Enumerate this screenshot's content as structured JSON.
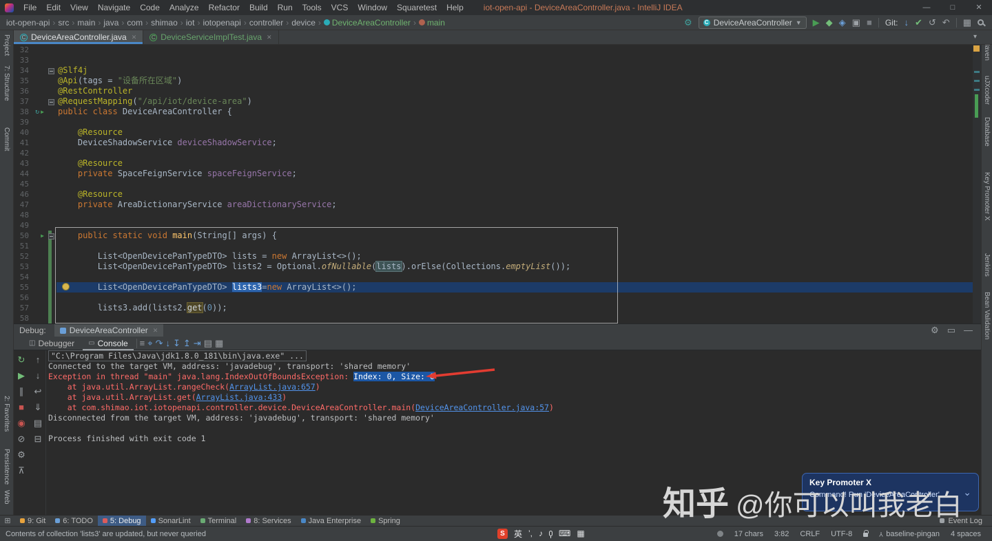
{
  "titlebar": {
    "menu": [
      "File",
      "Edit",
      "View",
      "Navigate",
      "Code",
      "Analyze",
      "Refactor",
      "Build",
      "Run",
      "Tools",
      "VCS",
      "Window",
      "Squaretest",
      "Help"
    ],
    "title": "iot-open-api - DeviceAreaController.java - IntelliJ IDEA",
    "controls": [
      {
        "name": "minimize-button",
        "glyph": "—"
      },
      {
        "name": "maximize-button",
        "glyph": "□"
      },
      {
        "name": "close-button",
        "glyph": "✕"
      }
    ]
  },
  "navbar": {
    "breadcrumbs": [
      {
        "label": "iot-open-api"
      },
      {
        "label": "src"
      },
      {
        "label": "main"
      },
      {
        "label": "java"
      },
      {
        "label": "com"
      },
      {
        "label": "shimao"
      },
      {
        "label": "iot"
      },
      {
        "label": "iotopenapi"
      },
      {
        "label": "controller"
      },
      {
        "label": "device"
      },
      {
        "label": "DeviceAreaController",
        "icon": "class",
        "accent": true
      },
      {
        "label": "main",
        "icon": "method",
        "accent": true
      }
    ],
    "run_config": "DeviceAreaController",
    "git_label": "Git:",
    "actions_left": [
      {
        "name": "wrench-icon",
        "glyph": "⚙",
        "color": "#3f9e9a"
      }
    ],
    "actions_run": [
      {
        "name": "run-icon",
        "glyph": "▶",
        "color": "#499c54"
      },
      {
        "name": "debug-icon",
        "glyph": "◆",
        "color": "#73bd79"
      },
      {
        "name": "profiler-icon",
        "glyph": "◈",
        "color": "#6a9fd8"
      },
      {
        "name": "coverage-icon",
        "glyph": "▣",
        "color": "#9da2a6"
      },
      {
        "name": "stop-icon",
        "glyph": "■",
        "color": "#777b80"
      }
    ],
    "actions_git": [
      {
        "name": "git-update-icon",
        "glyph": "↓",
        "color": "#6a9fd8"
      },
      {
        "name": "git-commit-icon",
        "glyph": "✔",
        "color": "#73bd79"
      },
      {
        "name": "history-icon",
        "glyph": "↺",
        "color": "#9da2a6"
      },
      {
        "name": "rollback-icon",
        "glyph": "↶",
        "color": "#9da2a6"
      }
    ],
    "actions_end": [
      {
        "name": "layout-icon",
        "glyph": "▦",
        "color": "#9da2a6"
      }
    ]
  },
  "editor_tabs": [
    {
      "label": "DeviceAreaController.java",
      "letter": "C",
      "active": true
    },
    {
      "label": "DeviceServiceImplTest.java",
      "letter": "C",
      "test": true
    }
  ],
  "left_strip": {
    "top": [
      "Project",
      "7: Structure",
      "Commit"
    ],
    "bottom": [
      "2: Favorites",
      "Persistence",
      "Web"
    ]
  },
  "right_strip": [
    "Maven",
    "uJXcoder",
    "Database",
    "Key Promoter X",
    "Jenkins",
    "Bean Validation"
  ],
  "editor": {
    "lines": [
      {
        "n": 32,
        "s": []
      },
      {
        "n": 33,
        "s": []
      },
      {
        "n": 34,
        "g": [
          "fold"
        ],
        "s": [
          [
            "@Slf4j",
            "ann"
          ]
        ]
      },
      {
        "n": 35,
        "s": [
          [
            "@Api",
            "ann"
          ],
          [
            "(tags = ",
            "p"
          ],
          [
            "\"设备所在区域\"",
            "str"
          ],
          [
            ")",
            "p"
          ]
        ]
      },
      {
        "n": 36,
        "s": [
          [
            "@RestController",
            "ann"
          ]
        ]
      },
      {
        "n": 37,
        "g": [
          "fold"
        ],
        "s": [
          [
            "@RequestMapping",
            "ann"
          ],
          [
            "(",
            "p"
          ],
          [
            "\"/api/iot/device-area\"",
            "str"
          ],
          [
            ")",
            "p"
          ]
        ]
      },
      {
        "n": 38,
        "g": [
          "runclass",
          "run"
        ],
        "s": [
          [
            "public class ",
            "kw"
          ],
          [
            "DeviceAreaController {",
            "p"
          ]
        ]
      },
      {
        "n": 39,
        "s": []
      },
      {
        "n": 40,
        "s": [
          [
            "    ",
            "p"
          ],
          [
            "@Resource",
            "ann"
          ]
        ]
      },
      {
        "n": 41,
        "s": [
          [
            "    DeviceShadowService ",
            "p"
          ],
          [
            "deviceShadowService",
            "fld"
          ],
          [
            ";",
            "p"
          ]
        ]
      },
      {
        "n": 42,
        "s": []
      },
      {
        "n": 43,
        "s": [
          [
            "    ",
            "p"
          ],
          [
            "@Resource",
            "ann"
          ]
        ]
      },
      {
        "n": 44,
        "s": [
          [
            "    ",
            "p"
          ],
          [
            "private ",
            "kw"
          ],
          [
            "SpaceFeignService ",
            "p"
          ],
          [
            "spaceFeignService",
            "fld"
          ],
          [
            ";",
            "p"
          ]
        ]
      },
      {
        "n": 45,
        "s": []
      },
      {
        "n": 46,
        "s": [
          [
            "    ",
            "p"
          ],
          [
            "@Resource",
            "ann"
          ]
        ]
      },
      {
        "n": 47,
        "s": [
          [
            "    ",
            "p"
          ],
          [
            "private ",
            "kw"
          ],
          [
            "AreaDictionaryService ",
            "p"
          ],
          [
            "areaDictionaryService",
            "fld"
          ],
          [
            ";",
            "p"
          ]
        ]
      },
      {
        "n": 48,
        "s": []
      },
      {
        "n": 49,
        "s": []
      },
      {
        "n": 50,
        "g": [
          "fold",
          "run"
        ],
        "v": true,
        "s": [
          [
            "    ",
            "p"
          ],
          [
            "public static void ",
            "kw"
          ],
          [
            "main",
            "meth"
          ],
          [
            "(String[] args) {",
            "p"
          ]
        ]
      },
      {
        "n": 51,
        "v": true,
        "s": []
      },
      {
        "n": 52,
        "v": true,
        "s": [
          [
            "        List<OpenDevicePanTypeDTO> lists = ",
            "p"
          ],
          [
            "new ",
            "kw"
          ],
          [
            "ArrayList<>();",
            "p"
          ]
        ]
      },
      {
        "n": 53,
        "v": true,
        "s": [
          [
            "        List<OpenDevicePanTypeDTO> lists2 = Optional.",
            "p"
          ],
          [
            "ofNullable",
            "it"
          ],
          [
            "(",
            "p"
          ],
          [
            "lists",
            "hl1"
          ],
          [
            ").orElse(Collections.",
            "p"
          ],
          [
            "emptyList",
            "it"
          ],
          [
            "());",
            "p"
          ]
        ]
      },
      {
        "n": 54,
        "v": true,
        "s": []
      },
      {
        "n": 55,
        "v": true,
        "caret": true,
        "s": [
          [
            "        List<OpenDevicePanTypeDTO> ",
            "p"
          ],
          [
            "lists3",
            "hl2"
          ],
          [
            "=",
            "p"
          ],
          [
            "new ",
            "kw"
          ],
          [
            "ArrayList<>();",
            "p"
          ]
        ]
      },
      {
        "n": 56,
        "v": true,
        "s": []
      },
      {
        "n": 57,
        "v": true,
        "s": [
          [
            "        lists3.add(lists2.",
            "p"
          ],
          [
            "get",
            "hl3"
          ],
          [
            "(",
            "p"
          ],
          [
            "0",
            "num"
          ],
          [
            "));",
            "p"
          ]
        ]
      },
      {
        "n": 58,
        "v": true,
        "s": []
      }
    ]
  },
  "debug": {
    "panel_label": "Debug:",
    "tab": "DeviceAreaController",
    "views": [
      {
        "label": "Debugger",
        "glyph": "◫",
        "active": false
      },
      {
        "label": "Console",
        "glyph": "▭",
        "active": true
      }
    ],
    "toolbar": [
      {
        "name": "options-menu-icon",
        "glyph": "≡"
      },
      {
        "name": "show-execution-point-icon",
        "glyph": "⌖",
        "color": "#6a9fd8"
      },
      {
        "name": "step-over-icon",
        "glyph": "↷",
        "color": "#6a9fd8"
      },
      {
        "name": "step-into-icon",
        "glyph": "↓",
        "color": "#6a9fd8"
      },
      {
        "name": "force-step-into-icon",
        "glyph": "↧",
        "color": "#6a9fd8"
      },
      {
        "name": "step-out-icon",
        "glyph": "↥",
        "color": "#6a9fd8"
      },
      {
        "name": "run-to-cursor-icon",
        "glyph": "⇥",
        "color": "#6a9fd8"
      },
      {
        "name": "evaluate-expression-icon",
        "glyph": "▤",
        "color": "#9da2a6"
      },
      {
        "name": "layout-settings-icon",
        "glyph": "▦",
        "color": "#9da2a6"
      }
    ],
    "left_actions": [
      {
        "name": "rerun-icon",
        "glyph": "↻",
        "color": "#73bd79"
      },
      {
        "name": "resume-icon",
        "glyph": "▶",
        "color": "#73bd79"
      },
      {
        "name": "pause-icon",
        "glyph": "∥",
        "color": "#9da2a6"
      },
      {
        "name": "stop-icon",
        "glyph": "■",
        "color": "#c75450"
      },
      {
        "name": "view-breakpoints-icon",
        "glyph": "◉",
        "color": "#c75450"
      },
      {
        "name": "mute-breakpoints-icon",
        "glyph": "⊘",
        "color": "#9da2a6"
      },
      {
        "name": "settings-icon",
        "glyph": "⚙",
        "color": "#9da2a6"
      },
      {
        "name": "pin-icon",
        "glyph": "⊼",
        "color": "#9da2a6"
      }
    ],
    "console_actions": [
      {
        "name": "jump-to-top-icon",
        "glyph": "↑",
        "color": "#9da2a6"
      },
      {
        "name": "jump-to-bottom-icon",
        "glyph": "↓",
        "color": "#9da2a6"
      },
      {
        "name": "soft-wrap-icon",
        "glyph": "↩",
        "color": "#9da2a6"
      },
      {
        "name": "scroll-to-end-icon",
        "glyph": "⇓",
        "color": "#9da2a6"
      },
      {
        "name": "print-icon",
        "glyph": "▤",
        "color": "#9da2a6"
      },
      {
        "name": "clear-console-icon",
        "glyph": "⊟",
        "color": "#9da2a6"
      }
    ],
    "header_actions": [
      {
        "name": "settings-gear-icon",
        "glyph": "⚙"
      },
      {
        "name": "float-mode-icon",
        "glyph": "▭"
      },
      {
        "name": "hide-icon",
        "glyph": "—"
      }
    ],
    "console": [
      {
        "s": [
          [
            "\"C:\\Program Files\\Java\\jdk1.8.0_181\\bin\\java.exe\" ...",
            "cmd"
          ]
        ]
      },
      {
        "s": [
          [
            "Connected to the target VM, address: 'javadebug', transport: 'shared memory'",
            "p"
          ]
        ]
      },
      {
        "s": [
          [
            "Exception in thread \"main\" java.lang.IndexOutOfBoundsException: ",
            "err"
          ],
          [
            "Index: 0, Size: 0",
            "sel"
          ]
        ]
      },
      {
        "s": [
          [
            "    at java.util.ArrayList.rangeCheck(",
            "err"
          ],
          [
            "ArrayList.java:657",
            "lnk"
          ],
          [
            ")",
            "err"
          ]
        ]
      },
      {
        "s": [
          [
            "    at java.util.ArrayList.get(",
            "err"
          ],
          [
            "ArrayList.java:433",
            "lnk"
          ],
          [
            ")",
            "err"
          ]
        ]
      },
      {
        "s": [
          [
            "    at com.shimao.iot.iotopenapi.controller.device.DeviceAreaController.main(",
            "err"
          ],
          [
            "DeviceAreaController.java:57",
            "lnk"
          ],
          [
            ")",
            "err"
          ]
        ]
      },
      {
        "s": [
          [
            "Disconnected from the target VM, address: 'javadebug', transport: 'shared memory'",
            "p"
          ]
        ]
      },
      {
        "s": []
      },
      {
        "s": [
          [
            "Process finished with exit code 1",
            "p"
          ]
        ]
      }
    ]
  },
  "bottom_bar": {
    "switcher": "⊞",
    "items": [
      {
        "label": "9: Git",
        "color": "#e8a33d"
      },
      {
        "label": "6: TODO",
        "color": "#6a9fd8"
      },
      {
        "label": "5: Debug",
        "color": "#db5c5c",
        "active": true
      },
      {
        "label": "SonarLint",
        "color": "#539df8"
      },
      {
        "label": "Terminal",
        "color": "#6aab73"
      },
      {
        "label": "8: Services",
        "color": "#b07acc"
      },
      {
        "label": "Java Enterprise",
        "color": "#4a88c7"
      },
      {
        "label": "Spring",
        "color": "#6db33f"
      }
    ],
    "event_log": "Event Log"
  },
  "statusbar": {
    "message": "Contents of collection 'lists3' are updated, but never queried",
    "ime": {
      "engine": "S",
      "lang": "英",
      "punct": "’,"
    },
    "right": [
      {
        "label": "17 chars"
      },
      {
        "label": "3:82"
      },
      {
        "label": "CRLF"
      },
      {
        "label": "UTF-8"
      },
      {
        "label": "",
        "icon": "lock"
      },
      {
        "label": "baseline-pingan",
        "icon": "branch"
      },
      {
        "label": "4 spaces"
      }
    ]
  },
  "notification": {
    "title": "Key Promoter X",
    "body": "Command! Run 'DeviceAreaController'",
    "chevron": "⌄"
  },
  "watermark": {
    "brand": "知乎",
    "handle": "@你可以叫我老白"
  }
}
